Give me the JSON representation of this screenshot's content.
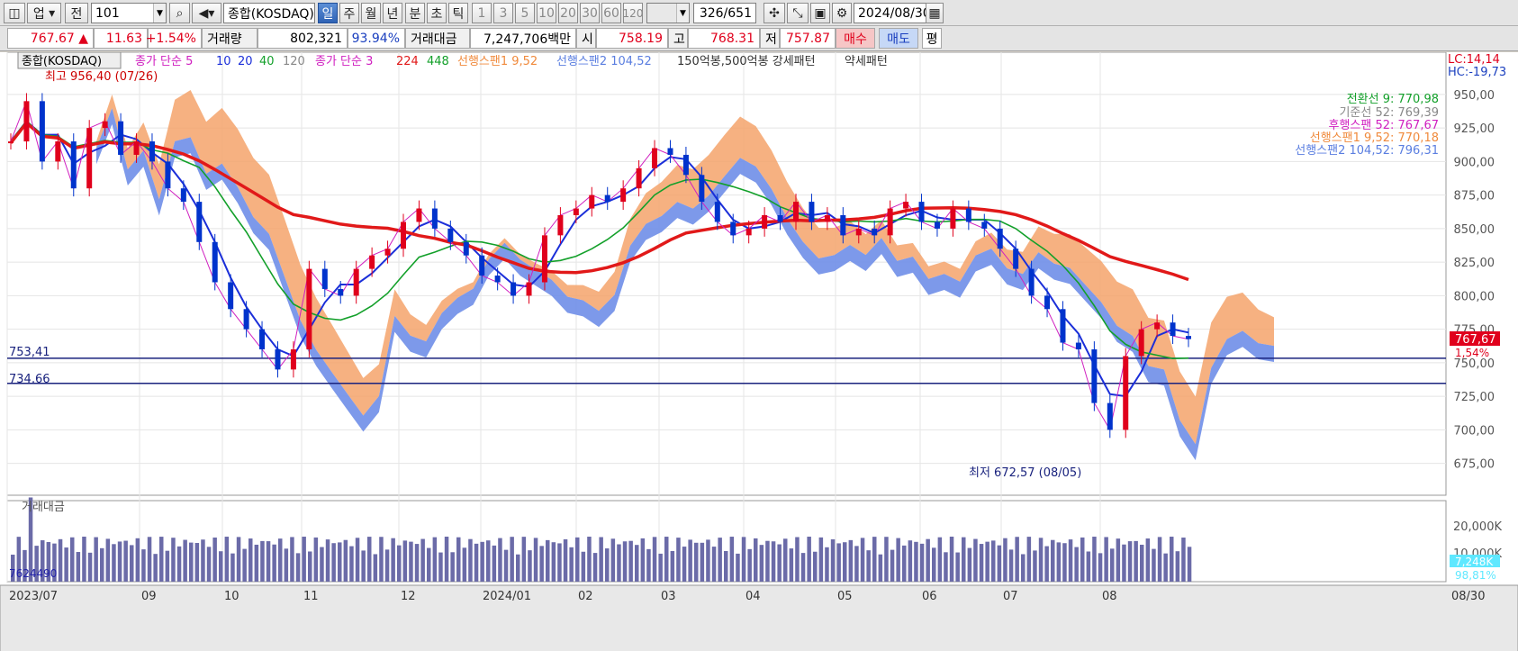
{
  "toolbar": {
    "market_btn": "업",
    "prev_btn": "전",
    "code": "101",
    "name": "종합(KOSDAQ)",
    "periods": [
      "일",
      "주",
      "월",
      "년"
    ],
    "minute_btns": [
      "분",
      "초",
      "틱"
    ],
    "intervals": [
      "1",
      "3",
      "5",
      "10",
      "20",
      "30",
      "60",
      "120"
    ],
    "count": "326",
    "total": "/651",
    "date": "2024/08/30"
  },
  "quote": {
    "price": "767.67 ▲",
    "change": "11.63",
    "change_pct": "+1.54%",
    "volume_label": "거래량",
    "volume": "802,321",
    "vol_ratio": "93.94%",
    "amount_label": "거래대금",
    "amount": "7,247,706백만",
    "open_label": "시",
    "open": "758.19",
    "high_label": "고",
    "high": "768.31",
    "low_label": "저",
    "low": "757.87",
    "buy": "매수",
    "sell": "매도",
    "even": "평"
  },
  "legend": {
    "name": "종합(KOSDAQ)",
    "ma_label": "종가 단순 5",
    "ma_items": [
      "10",
      "20",
      "40",
      "120"
    ],
    "ma2_label": "종가 단순 3",
    "ma2_items": [
      "224",
      "448"
    ],
    "span1": "선행스팬1 9,52",
    "span2": "선행스팬2 104,52",
    "pattern": "150억봉,500억봉 강세패턴",
    "weak": "약세패턴"
  },
  "ichimoku": {
    "conv": "전환선 9: 770,98",
    "base": "기준선 52: 769,39",
    "lag": "후행스팬 52: 767,67",
    "span1": "선행스팬1 9,52: 770,18",
    "span2": "선행스팬2 104,52: 796,31"
  },
  "right_labels": {
    "lc": "LC:14,14",
    "hc": "HC:-19,73",
    "price": "767,67",
    "pct": "1,54%"
  },
  "annotations": {
    "high": "최고 956,40 (07/26)",
    "low": "최저 672,57 (08/05)",
    "line1": "753,41",
    "line2": "734,66"
  },
  "vol_panel": {
    "title": "거래대금",
    "current": "7,248K",
    "pct": "98,81%",
    "left_val": "7624490"
  },
  "chart_data": {
    "type": "line",
    "y_ticks": [
      "950,00",
      "925,00",
      "900,00",
      "875,00",
      "850,00",
      "825,00",
      "800,00",
      "775,00",
      "750,00",
      "725,00",
      "700,00",
      "675,00"
    ],
    "ylim": [
      660,
      960
    ],
    "vol_ticks": [
      "20,000K",
      "10,000K"
    ],
    "x_labels": [
      "2023/07",
      "09",
      "10",
      "11",
      "12",
      "2024/01",
      "02",
      "03",
      "04",
      "05",
      "06",
      "07",
      "08",
      "08/30"
    ],
    "hlines": [
      753.41,
      734.66
    ],
    "colors": {
      "up": "#e0001c",
      "down": "#0033cc",
      "cloud_up": "#f5a36b",
      "cloud_dn": "#6f8ee8",
      "ma_blue": "#1b2fd9",
      "ma_green": "#13a02a",
      "ma_red": "#e11919",
      "vol": "#6b6ba8"
    },
    "series": [
      {
        "name": "close",
        "values": [
          915,
          945,
          900,
          915,
          880,
          925,
          930,
          905,
          915,
          900,
          880,
          870,
          840,
          810,
          790,
          775,
          760,
          745,
          760,
          820,
          805,
          800,
          820,
          830,
          835,
          855,
          865,
          850,
          840,
          830,
          815,
          810,
          800,
          810,
          845,
          860,
          865,
          875,
          870,
          880,
          895,
          910,
          905,
          890,
          870,
          855,
          845,
          850,
          860,
          855,
          870,
          855,
          860,
          845,
          850,
          845,
          865,
          870,
          855,
          850,
          865,
          855,
          850,
          835,
          820,
          800,
          790,
          765,
          760,
          720,
          700,
          755,
          775,
          780,
          770,
          767.67
        ]
      }
    ]
  }
}
